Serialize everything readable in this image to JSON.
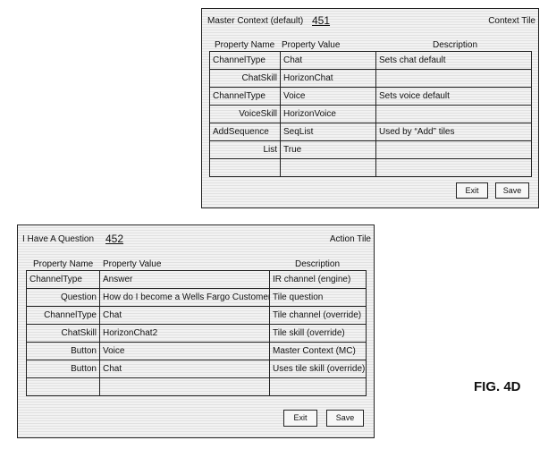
{
  "master": {
    "title": "Master Context (default)",
    "ref": "451",
    "tile_type": "Context Tile",
    "columns": [
      "Property Name",
      "Property Value",
      "Description"
    ],
    "rows": [
      {
        "name": "ChannelType",
        "value": "Chat",
        "desc": "Sets chat default"
      },
      {
        "name": "ChatSkill",
        "value": "HorizonChat",
        "desc": ""
      },
      {
        "name": "ChannelType",
        "value": "Voice",
        "desc": "Sets voice default"
      },
      {
        "name": "VoiceSkill",
        "value": "HorizonVoice",
        "desc": ""
      },
      {
        "name": "AddSequence",
        "value": "SeqList",
        "desc": "Used by “Add” tiles"
      },
      {
        "name": "List",
        "value": "True",
        "desc": ""
      },
      {
        "name": "",
        "value": "",
        "desc": ""
      }
    ],
    "exit_label": "Exit",
    "save_label": "Save"
  },
  "action": {
    "title": "I Have A Question",
    "ref": "452",
    "tile_type": "Action Tile",
    "columns": [
      "Property Name",
      "Property Value",
      "Description"
    ],
    "rows": [
      {
        "name": "ChannelType",
        "value": "Answer",
        "desc": "IR channel (engine)"
      },
      {
        "name": "Question",
        "value": "How do I become a Wells Fargo Customer",
        "desc": "Tile question"
      },
      {
        "name": "ChannelType",
        "value": "Chat",
        "desc": "Tile channel (override)"
      },
      {
        "name": "ChatSkill",
        "value": "HorizonChat2",
        "desc": "Tile skill (override)"
      },
      {
        "name": "Button",
        "value": "Voice",
        "desc": "Master Context (MC)"
      },
      {
        "name": "Button",
        "value": "Chat",
        "desc": "Uses tile skill (override)"
      },
      {
        "name": "",
        "value": "",
        "desc": ""
      }
    ],
    "exit_label": "Exit",
    "save_label": "Save"
  },
  "figure_label": "FIG. 4D"
}
